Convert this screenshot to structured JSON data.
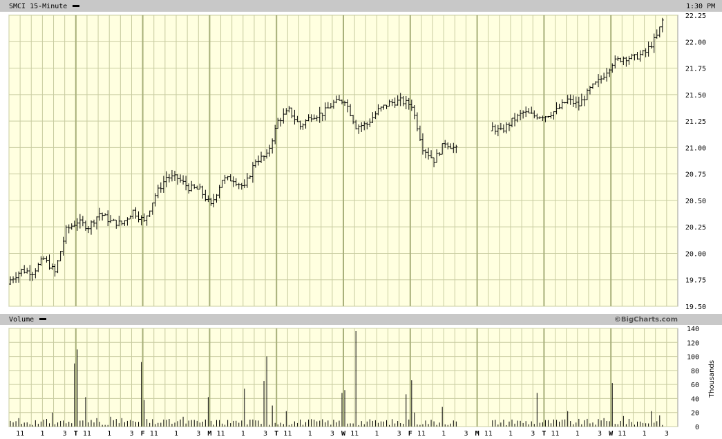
{
  "header": {
    "title": "SMCI 15-Minute",
    "time": "1:30 PM"
  },
  "volume_header": {
    "title": "Volume",
    "watermark": "©BigCharts.com"
  },
  "colors": {
    "plot_bg": "#ffffe0",
    "grid": "#c8cca0",
    "grid_major": "#a8b07a",
    "bar": "#000000",
    "header_bg": "#c8c8c8"
  },
  "chart_data": [
    {
      "type": "bar",
      "title": "SMCI 15-Minute",
      "subtype": "ohlc",
      "ylim": [
        19.5,
        22.25
      ],
      "yticks": [
        "22.25",
        "22.00",
        "21.75",
        "21.50",
        "21.25",
        "21.00",
        "20.75",
        "20.50",
        "20.25",
        "20.00",
        "19.75",
        "19.50"
      ],
      "grid": true,
      "day_labels": [
        "T",
        "F",
        "M",
        "T",
        "W",
        "F",
        "M",
        "T",
        "W"
      ],
      "hour_labels": [
        "11",
        "1",
        "3"
      ],
      "approx_series": [
        [
          0,
          19.75
        ],
        [
          4,
          19.84
        ],
        [
          8,
          19.82
        ],
        [
          12,
          19.95
        ],
        [
          16,
          19.82
        ],
        [
          20,
          20.22
        ],
        [
          24,
          20.3
        ],
        [
          28,
          20.25
        ],
        [
          32,
          20.38
        ],
        [
          36,
          20.3
        ],
        [
          40,
          20.28
        ],
        [
          44,
          20.4
        ],
        [
          48,
          20.3
        ],
        [
          52,
          20.55
        ],
        [
          56,
          20.72
        ],
        [
          60,
          20.71
        ],
        [
          64,
          20.62
        ],
        [
          68,
          20.6
        ],
        [
          72,
          20.45
        ],
        [
          76,
          20.7
        ],
        [
          80,
          20.7
        ],
        [
          84,
          20.62
        ],
        [
          88,
          20.88
        ],
        [
          92,
          20.92
        ],
        [
          96,
          21.25
        ],
        [
          100,
          21.35
        ],
        [
          104,
          21.2
        ],
        [
          108,
          21.3
        ],
        [
          112,
          21.32
        ],
        [
          116,
          21.42
        ],
        [
          120,
          21.45
        ],
        [
          124,
          21.2
        ],
        [
          128,
          21.22
        ],
        [
          132,
          21.35
        ],
        [
          136,
          21.42
        ],
        [
          140,
          21.44
        ],
        [
          144,
          21.4
        ],
        [
          148,
          21.0
        ],
        [
          152,
          20.88
        ],
        [
          156,
          21.05
        ],
        [
          160,
          20.98
        ],
        [
          172,
          21.2
        ],
        [
          176,
          21.15
        ],
        [
          180,
          21.25
        ],
        [
          184,
          21.33
        ],
        [
          188,
          21.3
        ],
        [
          192,
          21.3
        ],
        [
          196,
          21.35
        ],
        [
          200,
          21.45
        ],
        [
          204,
          21.4
        ],
        [
          208,
          21.55
        ],
        [
          212,
          21.65
        ],
        [
          216,
          21.8
        ],
        [
          220,
          21.85
        ],
        [
          224,
          21.85
        ],
        [
          228,
          21.9
        ],
        [
          232,
          22.05
        ],
        [
          234,
          22.2
        ]
      ]
    },
    {
      "type": "bar",
      "title": "Volume",
      "ylabel": "Thousands",
      "ylim": [
        0,
        140
      ],
      "yticks": [
        "140",
        "120",
        "100",
        "80",
        "60",
        "40",
        "20",
        "0"
      ],
      "spikes": [
        [
          0,
          8
        ],
        [
          3,
          12
        ],
        [
          6,
          6
        ],
        [
          10,
          4
        ],
        [
          15,
          20
        ],
        [
          18,
          8
        ],
        [
          23,
          90
        ],
        [
          24,
          110
        ],
        [
          27,
          42
        ],
        [
          31,
          12
        ],
        [
          36,
          14
        ],
        [
          40,
          12
        ],
        [
          44,
          8
        ],
        [
          47,
          92
        ],
        [
          48,
          38
        ],
        [
          55,
          10
        ],
        [
          62,
          14
        ],
        [
          71,
          42
        ],
        [
          72,
          8
        ],
        [
          80,
          8
        ],
        [
          84,
          54
        ],
        [
          91,
          65
        ],
        [
          92,
          100
        ],
        [
          94,
          30
        ],
        [
          99,
          22
        ],
        [
          119,
          48
        ],
        [
          120,
          52
        ],
        [
          124,
          136
        ],
        [
          130,
          8
        ],
        [
          142,
          46
        ],
        [
          144,
          66
        ],
        [
          145,
          20
        ],
        [
          155,
          28
        ],
        [
          168,
          6
        ],
        [
          180,
          10
        ],
        [
          189,
          48
        ],
        [
          200,
          22
        ],
        [
          213,
          12
        ],
        [
          216,
          62
        ],
        [
          220,
          15
        ],
        [
          230,
          22
        ],
        [
          233,
          16
        ]
      ]
    }
  ]
}
